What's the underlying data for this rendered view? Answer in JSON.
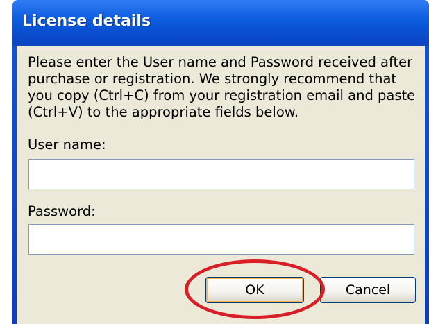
{
  "dialog": {
    "title": "License details",
    "instructions": "Please enter the User name and Password received after purchase or registration. We strongly recommend that you copy (Ctrl+C) from your registration email and paste (Ctrl+V) to the appropriate fields below.",
    "username_label": "User name:",
    "username_value": "",
    "password_label": "Password:",
    "password_value": "",
    "ok_label": "OK",
    "cancel_label": "Cancel"
  },
  "colors": {
    "titlebar": "#0a4fd1",
    "client_background": "#ece9d8",
    "highlight_circle": "#d61f26"
  }
}
